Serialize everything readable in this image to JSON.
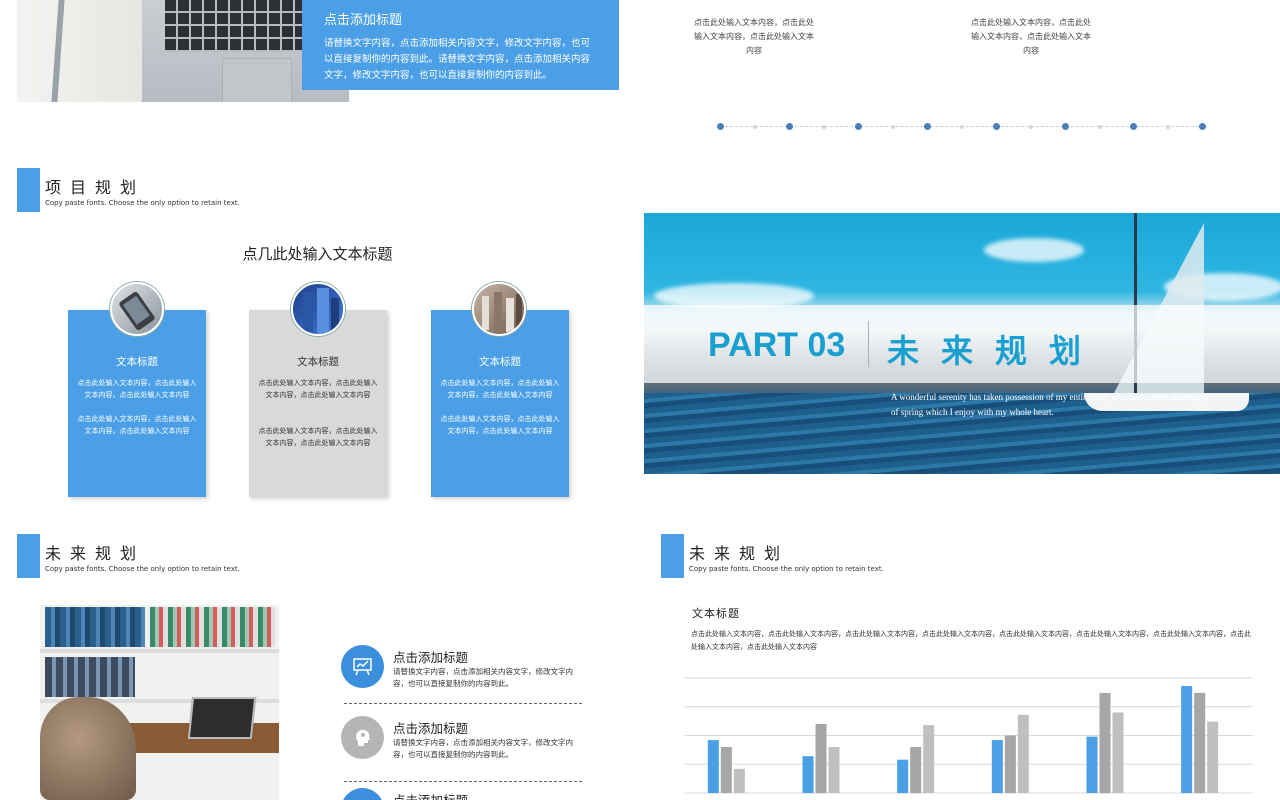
{
  "top_left": {
    "box_title": "点击添加标题",
    "box_text": "请替换文字内容，点击添加相关内容文字，修改文字内容，也可以直接复制你的内容到此。请替换文字内容，点击添加相关内容文字，修改文字内容，也可以直接复制你的内容到此。"
  },
  "top_right": {
    "text_1": "点击此处输入文本内容，点击此处输入文本内容，点击此处输入文本内容",
    "text_2": "点击此处输入文本内容，点击此处输入文本内容，点击此处输入文本内容"
  },
  "project_plan": {
    "title": "项目规划",
    "subtitle": "Copy paste fonts. Choose the only option to retain text.",
    "heading": "点几此处输入文本标题",
    "cards": [
      {
        "title": "文本标题",
        "text_1": "点击此处输入文本内容，点击此处输入文本内容，点击此处输入文本内容",
        "text_2": "点击此处输入文本内容，点击此处输入文本内容，点击此处输入文本内容"
      },
      {
        "title": "文本标题",
        "text_1": "点击此处输入文本内容，点击此处输入文本内容，点击此处输入文本内容",
        "text_2": "点击此处输入文本内容，点击此处输入文本内容，点击此处输入文本内容"
      },
      {
        "title": "文本标题",
        "text_1": "点击此处输入文本内容，点击此处输入文本内容，点击此处输入文本内容",
        "text_2": "点击此处输入文本内容，点击此处输入文本内容，点击此处输入文本内容"
      }
    ]
  },
  "banner": {
    "part": "PART 03",
    "title": "未来规划",
    "quote": "A wonderful serenity has taken possession of my entire soul, like these sweet mornings of spring which I enjoy with my whole heart."
  },
  "future_plan_left": {
    "title": "未来规划",
    "subtitle": "Copy paste fonts. Choose the only option to retain text.",
    "items": [
      {
        "title": "点击添加标题",
        "text": "请替换文字内容，点击添加相关内容文字，修改文字内容，也可以直接复制你的内容到此。",
        "icon": "presentation-icon"
      },
      {
        "title": "点击添加标题",
        "text": "请替换文字内容，点击添加相关内容文字，修改文字内容，也可以直接复制你的内容到此。",
        "icon": "head-idea-icon"
      },
      {
        "title": "点击添加标题",
        "text": "",
        "icon": "circle-icon"
      }
    ]
  },
  "future_plan_right": {
    "title": "未来规划",
    "subtitle": "Copy paste fonts. Choose the only option to retain text.",
    "chart_title": "文本标题",
    "chart_desc": "点击此处输入文本内容，点击此处输入文本内容，点击此处输入文本内容，点击此处输入文本内容，点击此处输入文本内容，点击此处输入文本内容，点击此处输入文本内容，点击此处输入文本内容，点击此处输入文本内容"
  },
  "colors": {
    "accent": "#4a9fe6",
    "grey_bar": "#a6a6a6",
    "light_grey_bar": "#bfbfbf",
    "card_grey": "#d9d9d9"
  },
  "chart_data": {
    "type": "bar",
    "categories": [
      "",
      "",
      "",
      "",
      "",
      ""
    ],
    "series": [
      {
        "values": [
          4.6,
          3.2,
          2.9,
          4.6,
          4.9,
          9.3
        ],
        "color": "#4a9fe6"
      },
      {
        "values": [
          4.0,
          6.0,
          4.0,
          5.0,
          8.7,
          8.7
        ],
        "color": "#a6a6a6"
      },
      {
        "values": [
          2.1,
          4.0,
          5.9,
          6.8,
          7.0,
          6.2
        ],
        "color": "#bfbfbf"
      }
    ],
    "ylim": [
      0,
      10
    ],
    "grid": true
  }
}
